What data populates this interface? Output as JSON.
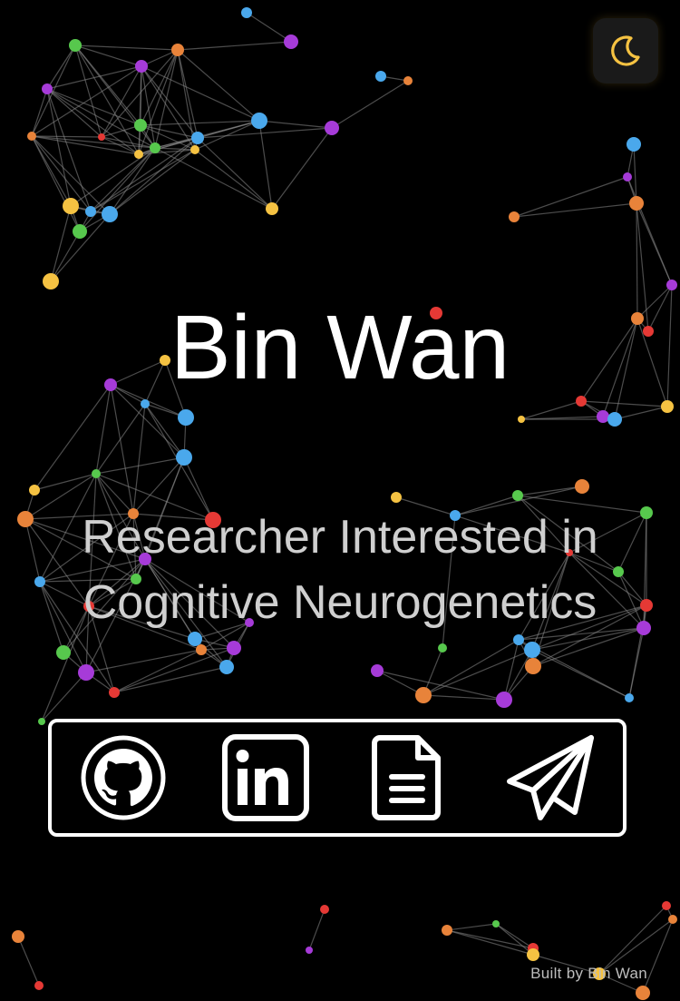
{
  "header": {
    "theme_toggle_icon": "moon-icon",
    "theme_toggle_color": "#f5c242"
  },
  "hero": {
    "name": "Bin Wan",
    "tagline": "Researcher Interested in Cognitive Neurogenetics"
  },
  "social": [
    {
      "icon": "github-icon",
      "name": "GitHub"
    },
    {
      "icon": "linkedin-icon",
      "name": "LinkedIn"
    },
    {
      "icon": "document-icon",
      "name": "CV"
    },
    {
      "icon": "paper-plane-icon",
      "name": "Contact"
    }
  ],
  "footer": {
    "text": "Built by Bin Wan"
  },
  "colors": {
    "background": "#000000",
    "node_palette": [
      "#f5c242",
      "#e8833a",
      "#e53935",
      "#a63bd8",
      "#4aa8ec",
      "#57c84d"
    ]
  }
}
